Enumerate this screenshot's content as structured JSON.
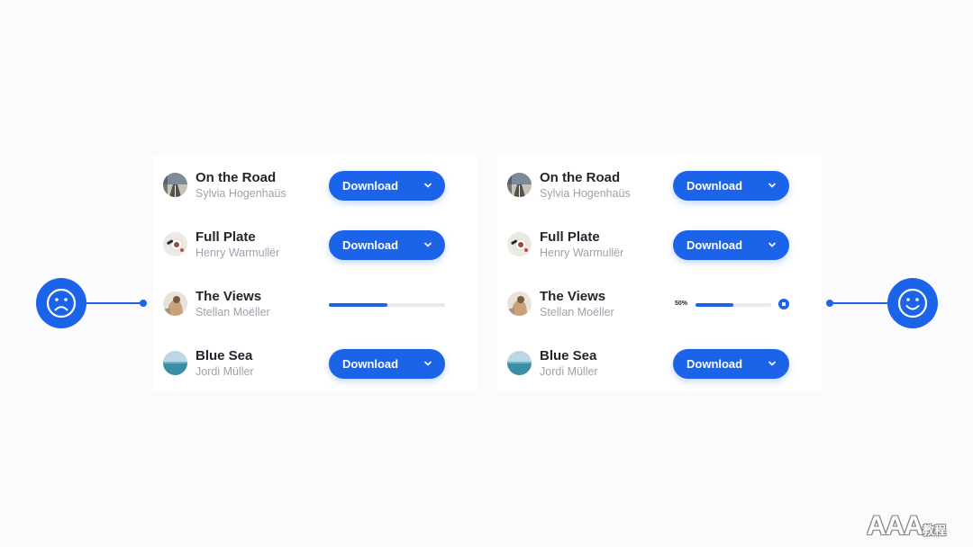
{
  "colors": {
    "accent": "#1b63e8",
    "track": "#e6e9ef",
    "title": "#23262d",
    "subtitle": "#9ea2ab"
  },
  "left_panel": {
    "status": "sad-face-icon",
    "items": [
      {
        "title": "On the Road",
        "artist": "Sylvia Hogenhaüs",
        "thumbnail": "road-thumbnail",
        "button_label": "Download"
      },
      {
        "title": "Full Plate",
        "artist": "Henry Warmullër",
        "thumbnail": "plate-thumbnail",
        "button_label": "Download"
      },
      {
        "title": "The Views",
        "artist": "Stellan Moëller",
        "thumbnail": "views-thumbnail",
        "progress": 0.5
      },
      {
        "title": "Blue Sea",
        "artist": "Jordi Müller",
        "thumbnail": "sea-thumbnail",
        "button_label": "Download"
      }
    ]
  },
  "right_panel": {
    "status": "happy-face-icon",
    "items": [
      {
        "title": "On the Road",
        "artist": "Sylvia Hogenhaüs",
        "thumbnail": "road-thumbnail",
        "button_label": "Download"
      },
      {
        "title": "Full Plate",
        "artist": "Henry Warmullër",
        "thumbnail": "plate-thumbnail",
        "button_label": "Download"
      },
      {
        "title": "The Views",
        "artist": "Stellan Moëller",
        "thumbnail": "views-thumbnail",
        "progress": 0.5,
        "progress_label": "50%"
      },
      {
        "title": "Blue Sea",
        "artist": "Jordi Müller",
        "thumbnail": "sea-thumbnail",
        "button_label": "Download"
      }
    ]
  },
  "watermark": {
    "text": "AAA",
    "suffix": "教程"
  }
}
